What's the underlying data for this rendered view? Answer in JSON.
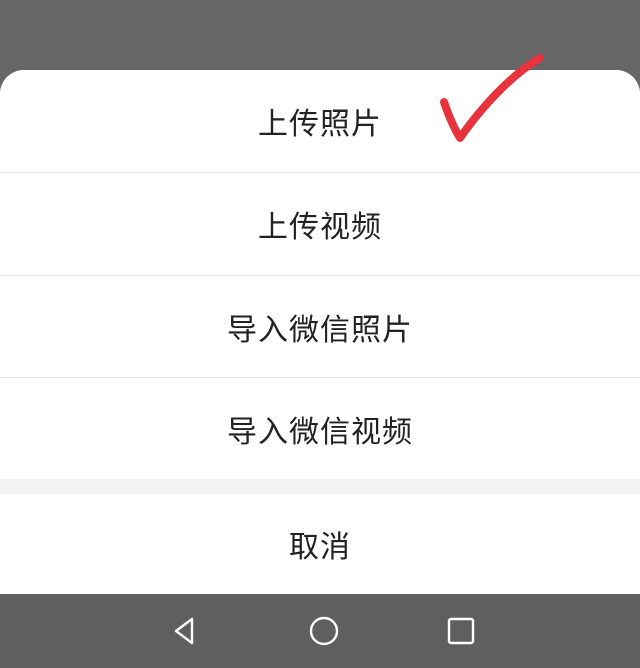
{
  "action_sheet": {
    "options": [
      {
        "label": "上传照片"
      },
      {
        "label": "上传视频"
      },
      {
        "label": "导入微信照片"
      },
      {
        "label": "导入微信视频"
      }
    ],
    "cancel_label": "取消"
  },
  "annotation": {
    "icon": "checkmark-icon",
    "color": "#e8323c"
  },
  "nav_bar": {
    "icons": [
      "back-triangle-icon",
      "home-circle-icon",
      "recents-square-icon"
    ],
    "color": "#ffffff"
  },
  "colors": {
    "dim_overlay": "#666666",
    "sheet_bg": "#ffffff",
    "text": "#222222",
    "divider": "#e2e2e2"
  }
}
